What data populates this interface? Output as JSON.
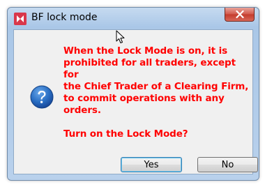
{
  "window": {
    "title": "BF lock mode"
  },
  "message": {
    "body": "When the Lock Mode is on, it is\nprohibited for all traders, except for\nthe Chief Trader of a Clearing Firm,\nto commit operations with any\norders.",
    "question": "Turn on the Lock Mode?"
  },
  "buttons": {
    "yes_label": "Yes",
    "no_label": "No"
  },
  "icons": {
    "app": "app-logo-icon",
    "question": "question-icon",
    "close": "close-icon",
    "cursor": "mouse-pointer-icon"
  },
  "colors": {
    "message_text": "#ff0000",
    "close_button": "#c43b2c",
    "question_icon": "#1f5fae"
  }
}
